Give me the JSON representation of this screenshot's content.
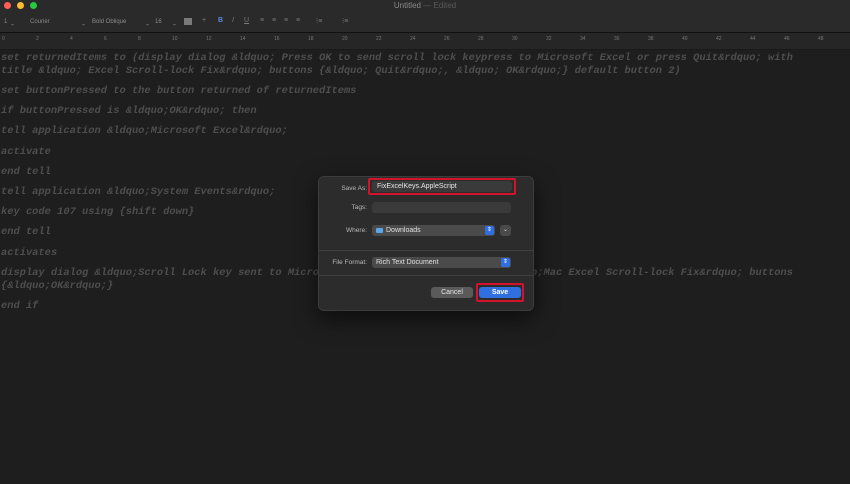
{
  "window": {
    "title": "Untitled",
    "title_suffix": "— Edited"
  },
  "toolbar": {
    "paragraph_style": "1",
    "font_family": "Courier",
    "font_typeface": "Bold Oblique",
    "font_size": "16",
    "bold_label": "B",
    "italic_label": "I",
    "underline_label": "U",
    "spacing_label": "1.0",
    "add_label": "+"
  },
  "ruler": {
    "ticks": [
      "0",
      "2",
      "4",
      "6",
      "8",
      "10",
      "12",
      "14",
      "16",
      "18",
      "20",
      "22",
      "24",
      "26",
      "28",
      "30",
      "32",
      "34",
      "36",
      "38",
      "40",
      "42",
      "44",
      "46",
      "48"
    ]
  },
  "document": {
    "lines": [
      "set returnedItems to (display dialog &ldquo; Press OK to send scroll lock keypress to Microsoft Excel or press Quit&rdquo; with",
      "title &ldquo; Excel Scroll-lock Fix&rdquo; buttons {&ldquo; Quit&rdquo;, &ldquo; OK&rdquo;} default button 2)",
      "set buttonPressed to the button returned of returnedItems",
      "if buttonPressed is &ldquo;OK&rdquo; then",
      "tell application &ldquo;Microsoft Excel&rdquo;",
      "activate",
      "end tell",
      "tell application &ldquo;System Events&rdquo;",
      "key code 107 using {shift down}",
      "end tell",
      "activates",
      "display dialog &ldquo;Scroll Lock key sent to Microsoft Excel&rdquo; with title &ldquo;Mac Excel Scroll-lock Fix&rdquo; buttons",
      "{&ldquo;OK&rdquo;}",
      "end if"
    ]
  },
  "save_dialog": {
    "save_as_label": "Save As:",
    "save_as_value": "FixExcelKeys.AppleScript",
    "tags_label": "Tags:",
    "tags_value": "",
    "where_label": "Where:",
    "where_value": "Downloads",
    "format_label": "File Format:",
    "format_value": "Rich Text Document",
    "cancel_label": "Cancel",
    "save_label": "Save"
  },
  "colors": {
    "accent": "#2f6fe0",
    "highlight": "#d3132b",
    "text_dim": "#4e4e4e"
  }
}
